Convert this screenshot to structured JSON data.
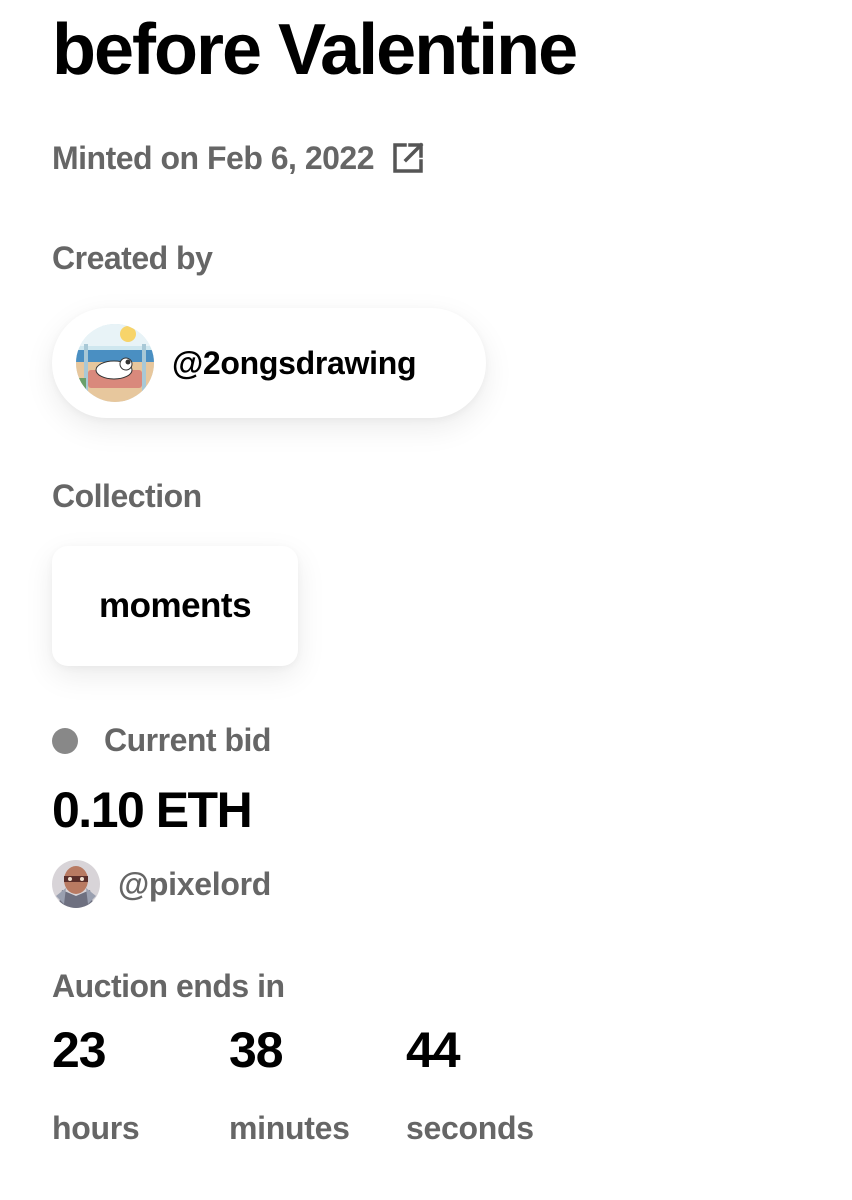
{
  "artwork": {
    "title": "before Valentine",
    "minted_text": "Minted on Feb 6, 2022",
    "external_link_icon": "external-link-icon"
  },
  "creator": {
    "label": "Created by",
    "handle": "@2ongsdrawing",
    "avatar_icon": "creator-avatar-cat-illustration"
  },
  "collection": {
    "label": "Collection",
    "name": "moments"
  },
  "bid": {
    "status_color": "#888888",
    "label": "Current bid",
    "amount": "0.10 ETH",
    "bidder_handle": "@pixelord",
    "bidder_avatar_icon": "bidder-avatar"
  },
  "auction": {
    "label": "Auction ends in",
    "countdown": [
      {
        "value": "23",
        "unit": "hours"
      },
      {
        "value": "38",
        "unit": "minutes"
      },
      {
        "value": "44",
        "unit": "seconds"
      }
    ]
  }
}
